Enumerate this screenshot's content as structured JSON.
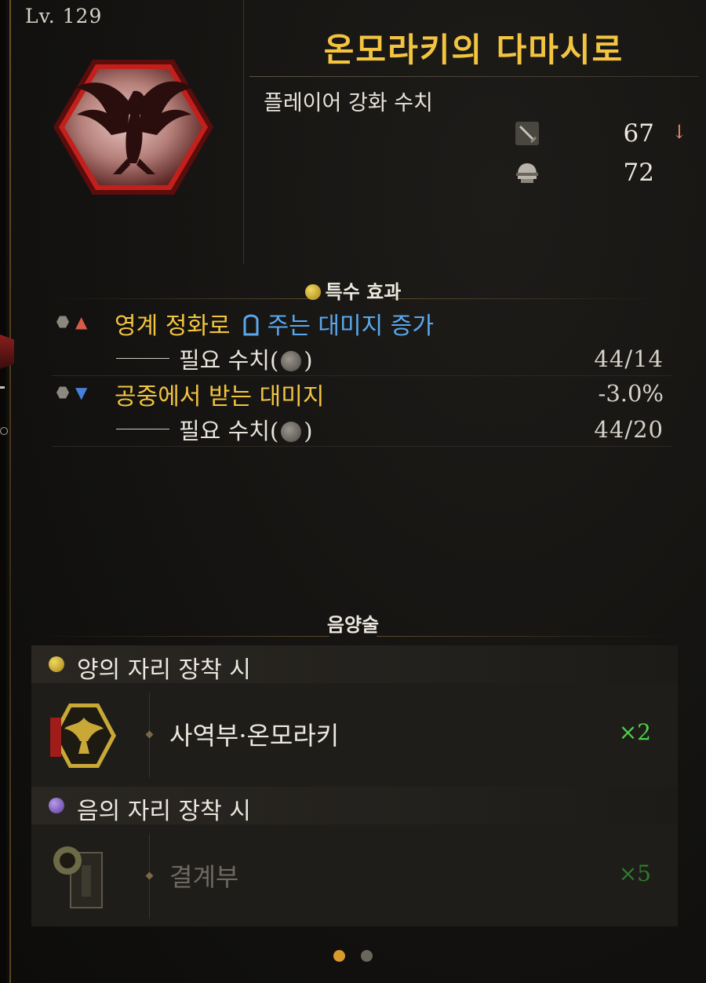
{
  "level": "Lv. 129",
  "title": "온모라키의 다마시로",
  "stats": {
    "label": "플레이어 강화 수치",
    "rows": [
      {
        "icon": "sword-icon",
        "value": "67",
        "trend": "↓",
        "trend_color": "#e8846a"
      },
      {
        "icon": "helmet-icon",
        "value": "72",
        "trend": ""
      }
    ]
  },
  "special_effects": {
    "heading": "특수 효과",
    "effects": [
      {
        "direction": "up",
        "arrow": "▲",
        "arrow_color": "#d85a48",
        "name": "영계 정화로",
        "name_suffix": "주는 대미지 증가",
        "value": "",
        "req_label": "필요 수치(",
        "req_close": ")",
        "req_value": "44/14"
      },
      {
        "direction": "down",
        "arrow": "▼",
        "arrow_color": "#4a7fd8",
        "name": "공중에서 받는 대미지",
        "name_suffix": "",
        "value": "-3.0%",
        "req_label": "필요 수치(",
        "req_close": ")",
        "req_value": "44/20"
      }
    ]
  },
  "onmyo": {
    "heading": "음양술",
    "groups": [
      {
        "label": "양의 자리 장착 시",
        "icon_color": "#d8b830",
        "item": "사역부·온모라키",
        "qty": "×2",
        "active": true
      },
      {
        "label": "음의 자리 장착 시",
        "icon_color": "#8a64c8",
        "item": "결계부",
        "qty": "×5",
        "active": false
      }
    ]
  },
  "pager": {
    "count": 2,
    "active": 0,
    "active_color": "#d89a2c",
    "inactive_color": "#6a665e"
  },
  "colors": {
    "title": "#f2c440",
    "accent_blue": "#5aa8ee",
    "qty_green": "#4fd04a"
  }
}
